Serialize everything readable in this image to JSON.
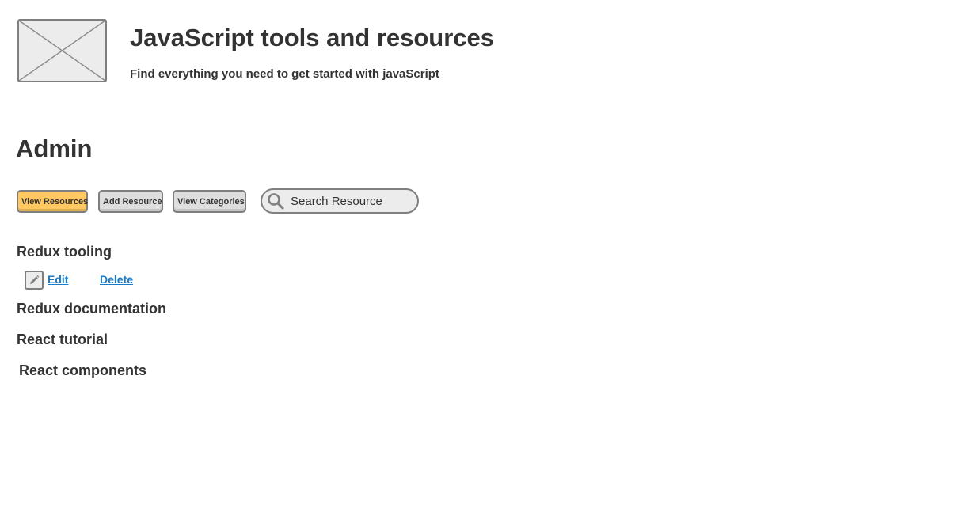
{
  "header": {
    "title": "JavaScript tools and resources",
    "subtitle": "Find everything you need to get started with javaScript"
  },
  "admin": {
    "heading": "Admin"
  },
  "toolbar": {
    "view_resources_label": "View Resources",
    "add_resource_label": "Add Resource",
    "view_categories_label": "View Categories",
    "active_button": "View Resources",
    "active_color": "#ffc861"
  },
  "search": {
    "placeholder": "Search Resource",
    "value": "",
    "icon": "search-icon"
  },
  "resources": [
    {
      "name": "Redux tooling",
      "actions": {
        "edit_label": "Edit",
        "delete_label": "Delete",
        "edit_icon": "pencil-icon"
      }
    },
    {
      "name": "Redux documentation"
    },
    {
      "name": "React tutorial"
    },
    {
      "name": "React components"
    }
  ],
  "colors": {
    "link": "#1b7ac5",
    "button_bg": "#dedede",
    "text": "#333333"
  }
}
